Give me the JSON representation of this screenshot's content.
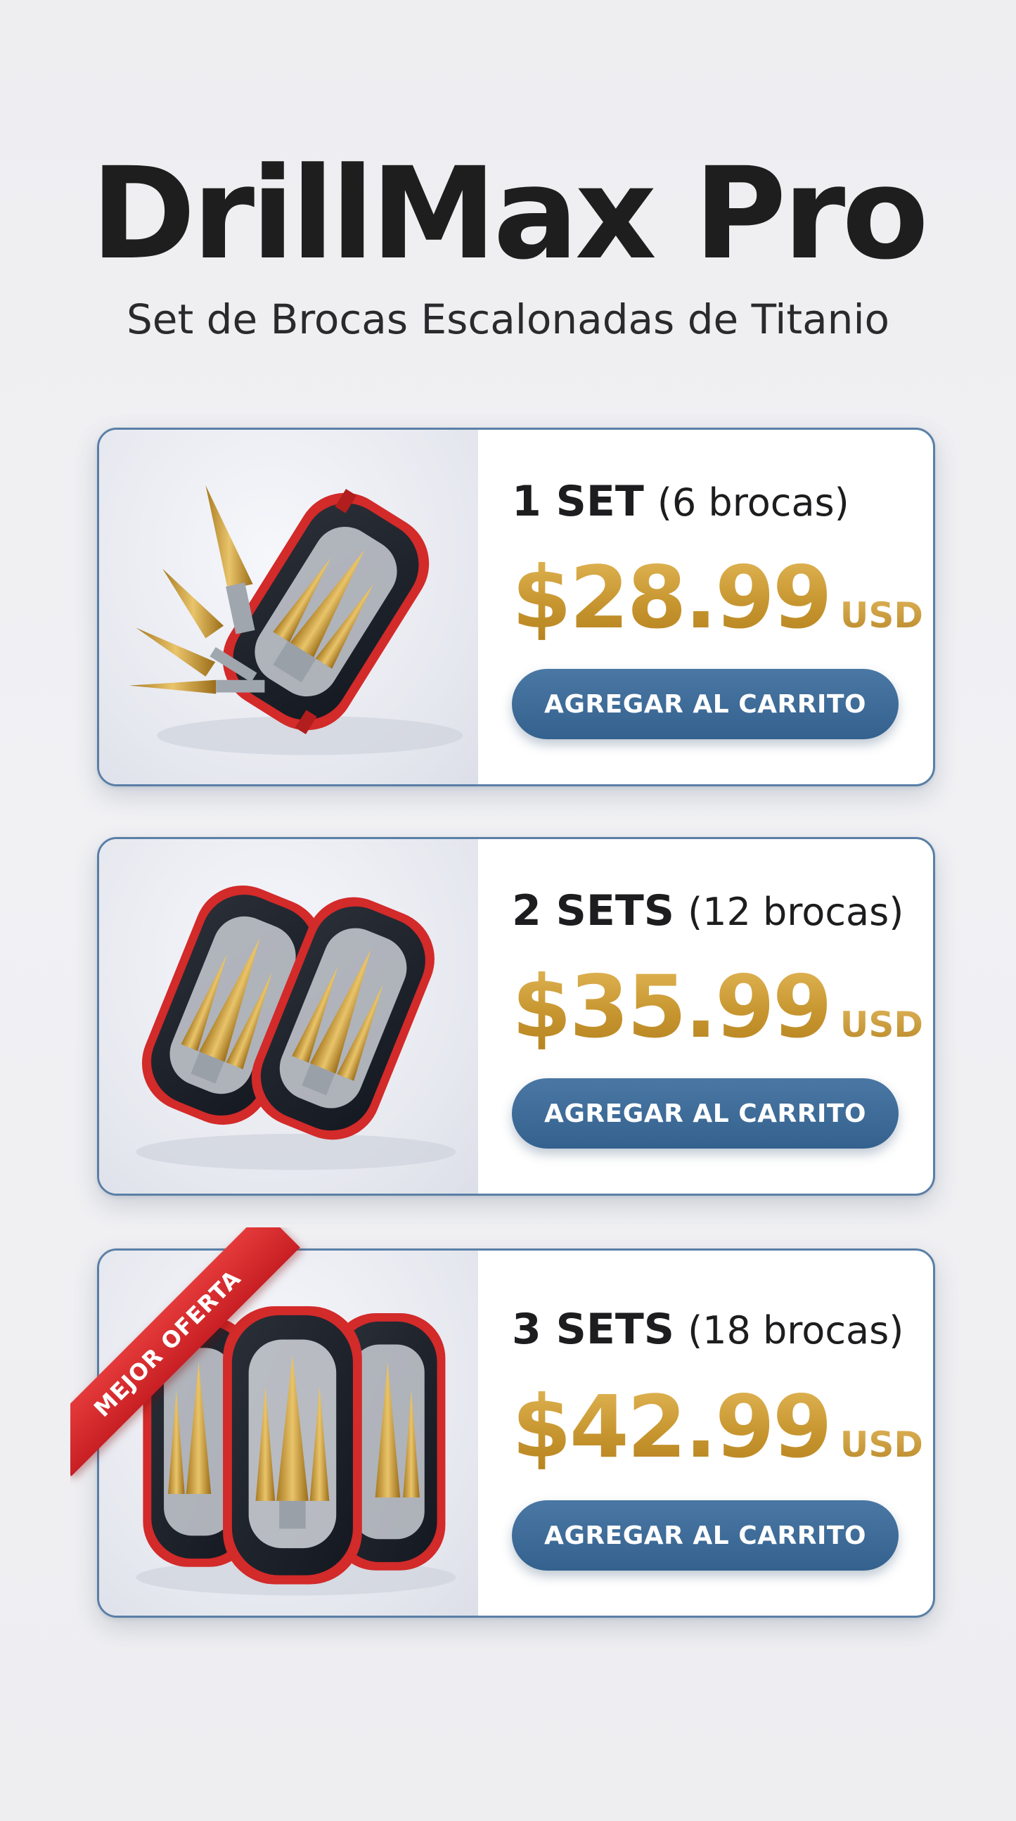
{
  "header": {
    "title": "DrillMax Pro",
    "subtitle": "Set de Brocas Escalonadas de Titanio"
  },
  "offers": [
    {
      "set_label": "1 SET",
      "count_label": "(6 brocas)",
      "price": "$28.99",
      "currency": "USD",
      "button_label": "AGREGAR AL CARRITO",
      "image": "single-drill-set-case-with-loose-step-bits"
    },
    {
      "set_label": "2 SETS",
      "count_label": "(12 brocas)",
      "price": "$35.99",
      "currency": "USD",
      "button_label": "AGREGAR AL CARRITO",
      "image": "two-drill-set-cases"
    },
    {
      "set_label": "3 SETS",
      "count_label": "(18 brocas)",
      "price": "$42.99",
      "currency": "USD",
      "button_label": "AGREGAR AL CARRITO",
      "image": "three-drill-set-cases",
      "badge": "MEJOR OFERTA"
    }
  ],
  "colors": {
    "price_gold": "#c79630",
    "button_blue": "#3b6896",
    "card_border": "#5a7fa7",
    "ribbon_red": "#d42a2e",
    "case_red": "#d32a2a",
    "case_dark": "#1f232b"
  }
}
